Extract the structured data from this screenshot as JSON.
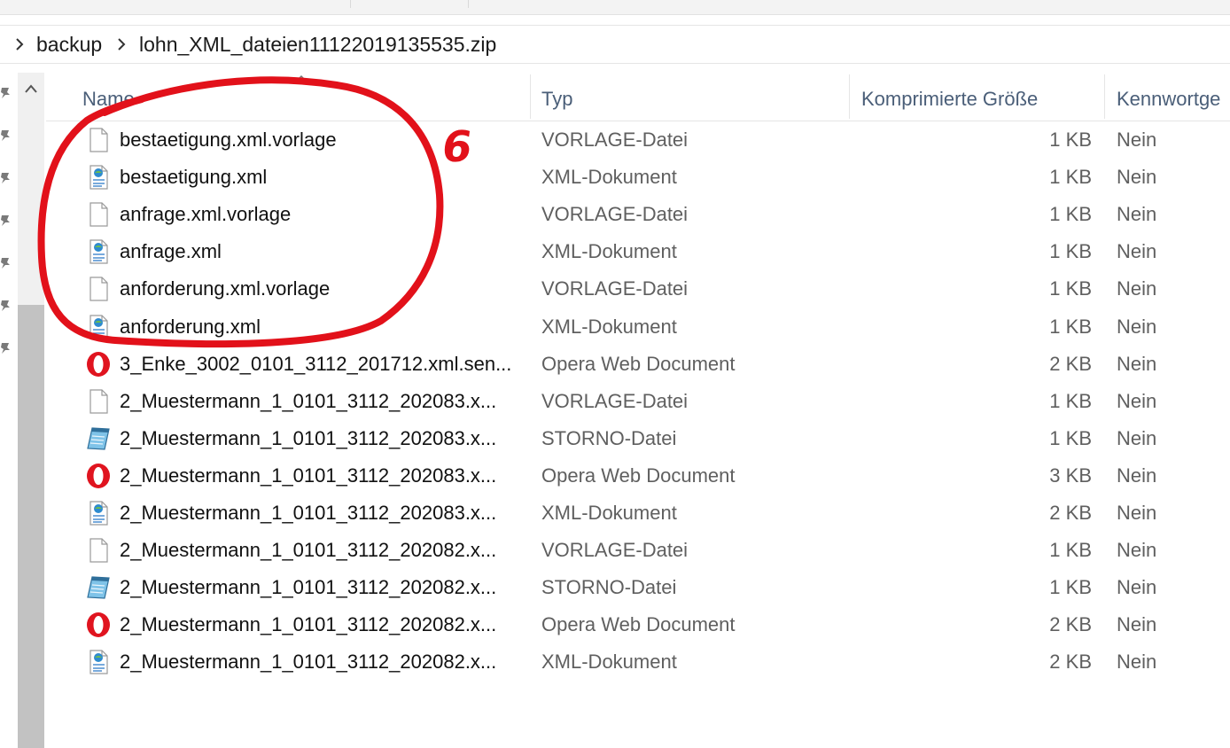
{
  "breadcrumb": {
    "items": [
      "backup",
      "lohn_XML_dateien11122019135535.zip"
    ]
  },
  "columns": {
    "name": "Name",
    "type": "Typ",
    "size": "Komprimierte Größe",
    "password": "Kennwortge"
  },
  "annotation": {
    "number": "6",
    "color": "#e2111a"
  },
  "files": [
    {
      "name": "bestaetigung.xml.vorlage",
      "type": "VORLAGE-Datei",
      "size": "1 KB",
      "password": "Nein",
      "icon": "blank-file-icon"
    },
    {
      "name": "bestaetigung.xml",
      "type": "XML-Dokument",
      "size": "1 KB",
      "password": "Nein",
      "icon": "xml-document-icon"
    },
    {
      "name": "anfrage.xml.vorlage",
      "type": "VORLAGE-Datei",
      "size": "1 KB",
      "password": "Nein",
      "icon": "blank-file-icon"
    },
    {
      "name": "anfrage.xml",
      "type": "XML-Dokument",
      "size": "1 KB",
      "password": "Nein",
      "icon": "xml-document-icon"
    },
    {
      "name": "anforderung.xml.vorlage",
      "type": "VORLAGE-Datei",
      "size": "1 KB",
      "password": "Nein",
      "icon": "blank-file-icon"
    },
    {
      "name": "anforderung.xml",
      "type": "XML-Dokument",
      "size": "1 KB",
      "password": "Nein",
      "icon": "xml-document-icon"
    },
    {
      "name": "3_Enke_3002_0101_3112_201712.xml.sen...",
      "type": "Opera Web Document",
      "size": "2 KB",
      "password": "Nein",
      "icon": "opera-icon"
    },
    {
      "name": "2_Muestermann_1_0101_3112_202083.x...",
      "type": "VORLAGE-Datei",
      "size": "1 KB",
      "password": "Nein",
      "icon": "blank-file-icon"
    },
    {
      "name": "2_Muestermann_1_0101_3112_202083.x...",
      "type": "STORNO-Datei",
      "size": "1 KB",
      "password": "Nein",
      "icon": "notepad-icon"
    },
    {
      "name": "2_Muestermann_1_0101_3112_202083.x...",
      "type": "Opera Web Document",
      "size": "3 KB",
      "password": "Nein",
      "icon": "opera-icon"
    },
    {
      "name": "2_Muestermann_1_0101_3112_202083.x...",
      "type": "XML-Dokument",
      "size": "2 KB",
      "password": "Nein",
      "icon": "xml-document-icon"
    },
    {
      "name": "2_Muestermann_1_0101_3112_202082.x...",
      "type": "VORLAGE-Datei",
      "size": "1 KB",
      "password": "Nein",
      "icon": "blank-file-icon"
    },
    {
      "name": "2_Muestermann_1_0101_3112_202082.x...",
      "type": "STORNO-Datei",
      "size": "1 KB",
      "password": "Nein",
      "icon": "notepad-icon"
    },
    {
      "name": "2_Muestermann_1_0101_3112_202082.x...",
      "type": "Opera Web Document",
      "size": "2 KB",
      "password": "Nein",
      "icon": "opera-icon"
    },
    {
      "name": "2_Muestermann_1_0101_3112_202082.x...",
      "type": "XML-Dokument",
      "size": "2 KB",
      "password": "Nein",
      "icon": "xml-document-icon"
    }
  ]
}
